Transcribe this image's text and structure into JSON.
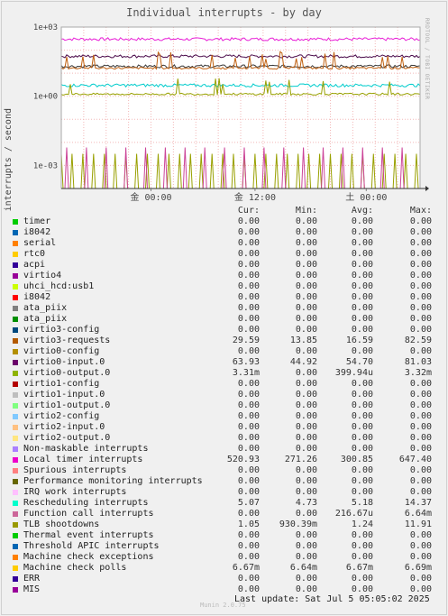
{
  "chart_data": {
    "type": "line",
    "title": "Individual interrupts - by day",
    "ylabel": "interrupts / second",
    "xlabel": "",
    "y_scale": "log",
    "ylim": [
      0.0001,
      1000
    ],
    "y_ticks": [
      {
        "value": 1000,
        "label": "1e+03"
      },
      {
        "value": 1,
        "label": "1e+00"
      },
      {
        "value": 0.001,
        "label": "1e-03"
      }
    ],
    "x_ticks": [
      "金 00:00",
      "金 12:00",
      "土 00:00"
    ],
    "grid": true,
    "series_levels": [
      {
        "name": "Local timer interrupts",
        "color": "#e81ed6",
        "value": 300.85,
        "style": "noisy"
      },
      {
        "name": "virtio0-input.0",
        "color": "#4a0a4a",
        "value": 54.7,
        "style": "noisy"
      },
      {
        "name": "Rescheduling interrupts",
        "color": "#3a3a3a",
        "value": 20,
        "style": "noisy"
      },
      {
        "name": "virtio3-requests",
        "color": "#c06010",
        "value": 16.59,
        "style": "spiky"
      },
      {
        "name": "Machine check polls",
        "color": "#00cccc",
        "value": 3,
        "style": "noisy"
      },
      {
        "name": "TLB shootdowns",
        "color": "#99a000",
        "value": 1.24,
        "style": "spiky"
      },
      {
        "name": "virtio0-output.0",
        "color": "#99a000",
        "value": 0.0004,
        "style": "spikes"
      },
      {
        "name": "Function call interrupts",
        "color": "#cc4499",
        "value": 0.0002,
        "style": "spikes2"
      }
    ]
  },
  "legend": {
    "headers": {
      "cur": "Cur:",
      "min": "Min:",
      "avg": "Avg:",
      "max": "Max:"
    },
    "rows": [
      {
        "name": "timer",
        "color": "#00cc00",
        "cur": "0.00",
        "min": "0.00",
        "avg": "0.00",
        "max": "0.00"
      },
      {
        "name": "i8042",
        "color": "#0066b3",
        "cur": "0.00",
        "min": "0.00",
        "avg": "0.00",
        "max": "0.00"
      },
      {
        "name": "serial",
        "color": "#ff8000",
        "cur": "0.00",
        "min": "0.00",
        "avg": "0.00",
        "max": "0.00"
      },
      {
        "name": "rtc0",
        "color": "#ffcc00",
        "cur": "0.00",
        "min": "0.00",
        "avg": "0.00",
        "max": "0.00"
      },
      {
        "name": "acpi",
        "color": "#330099",
        "cur": "0.00",
        "min": "0.00",
        "avg": "0.00",
        "max": "0.00"
      },
      {
        "name": "virtio4",
        "color": "#990099",
        "cur": "0.00",
        "min": "0.00",
        "avg": "0.00",
        "max": "0.00"
      },
      {
        "name": "uhci_hcd:usb1",
        "color": "#ccff00",
        "cur": "0.00",
        "min": "0.00",
        "avg": "0.00",
        "max": "0.00"
      },
      {
        "name": "i8042",
        "color": "#ff0000",
        "cur": "0.00",
        "min": "0.00",
        "avg": "0.00",
        "max": "0.00"
      },
      {
        "name": "ata_piix",
        "color": "#808080",
        "cur": "0.00",
        "min": "0.00",
        "avg": "0.00",
        "max": "0.00"
      },
      {
        "name": "ata_piix",
        "color": "#008f00",
        "cur": "0.00",
        "min": "0.00",
        "avg": "0.00",
        "max": "0.00"
      },
      {
        "name": "virtio3-config",
        "color": "#00487d",
        "cur": "0.00",
        "min": "0.00",
        "avg": "0.00",
        "max": "0.00"
      },
      {
        "name": "virtio3-requests",
        "color": "#b35a00",
        "cur": "29.59",
        "min": "13.85",
        "avg": "16.59",
        "max": "82.59"
      },
      {
        "name": "virtio0-config",
        "color": "#b38f00",
        "cur": "0.00",
        "min": "0.00",
        "avg": "0.00",
        "max": "0.00"
      },
      {
        "name": "virtio0-input.0",
        "color": "#6b006b",
        "cur": "63.93",
        "min": "44.92",
        "avg": "54.70",
        "max": "81.03"
      },
      {
        "name": "virtio0-output.0",
        "color": "#8fb300",
        "cur": "3.31m",
        "min": "0.00",
        "avg": "399.94u",
        "max": "3.32m"
      },
      {
        "name": "virtio1-config",
        "color": "#b30000",
        "cur": "0.00",
        "min": "0.00",
        "avg": "0.00",
        "max": "0.00"
      },
      {
        "name": "virtio1-input.0",
        "color": "#bebebe",
        "cur": "0.00",
        "min": "0.00",
        "avg": "0.00",
        "max": "0.00"
      },
      {
        "name": "virtio1-output.0",
        "color": "#80ff80",
        "cur": "0.00",
        "min": "0.00",
        "avg": "0.00",
        "max": "0.00"
      },
      {
        "name": "virtio2-config",
        "color": "#80c9ff",
        "cur": "0.00",
        "min": "0.00",
        "avg": "0.00",
        "max": "0.00"
      },
      {
        "name": "virtio2-input.0",
        "color": "#ffc080",
        "cur": "0.00",
        "min": "0.00",
        "avg": "0.00",
        "max": "0.00"
      },
      {
        "name": "virtio2-output.0",
        "color": "#ffe680",
        "cur": "0.00",
        "min": "0.00",
        "avg": "0.00",
        "max": "0.00"
      },
      {
        "name": "Non-maskable interrupts",
        "color": "#aa80ff",
        "cur": "0.00",
        "min": "0.00",
        "avg": "0.00",
        "max": "0.00"
      },
      {
        "name": "Local timer interrupts",
        "color": "#ee00cc",
        "cur": "520.93",
        "min": "271.26",
        "avg": "300.85",
        "max": "647.40"
      },
      {
        "name": "Spurious interrupts",
        "color": "#ff8080",
        "cur": "0.00",
        "min": "0.00",
        "avg": "0.00",
        "max": "0.00"
      },
      {
        "name": "Performance monitoring interrupts",
        "color": "#666600",
        "cur": "0.00",
        "min": "0.00",
        "avg": "0.00",
        "max": "0.00"
      },
      {
        "name": "IRQ work interrupts",
        "color": "#ffbfff",
        "cur": "0.00",
        "min": "0.00",
        "avg": "0.00",
        "max": "0.00"
      },
      {
        "name": "Rescheduling interrupts",
        "color": "#00ffcc",
        "cur": "5.07",
        "min": "4.73",
        "avg": "5.18",
        "max": "14.37"
      },
      {
        "name": "Function call interrupts",
        "color": "#cc6699",
        "cur": "0.00",
        "min": "0.00",
        "avg": "216.67u",
        "max": "6.64m"
      },
      {
        "name": "TLB shootdowns",
        "color": "#999900",
        "cur": "1.05",
        "min": "930.39m",
        "avg": "1.24",
        "max": "11.91"
      },
      {
        "name": "Thermal event interrupts",
        "color": "#00cc00",
        "cur": "0.00",
        "min": "0.00",
        "avg": "0.00",
        "max": "0.00"
      },
      {
        "name": "Threshold APIC interrupts",
        "color": "#0066b3",
        "cur": "0.00",
        "min": "0.00",
        "avg": "0.00",
        "max": "0.00"
      },
      {
        "name": "Machine check exceptions",
        "color": "#ff8000",
        "cur": "0.00",
        "min": "0.00",
        "avg": "0.00",
        "max": "0.00"
      },
      {
        "name": "Machine check polls",
        "color": "#ffcc00",
        "cur": "6.67m",
        "min": "6.64m",
        "avg": "6.67m",
        "max": "6.69m"
      },
      {
        "name": "ERR",
        "color": "#330099",
        "cur": "0.00",
        "min": "0.00",
        "avg": "0.00",
        "max": "0.00"
      },
      {
        "name": "MIS",
        "color": "#990099",
        "cur": "0.00",
        "min": "0.00",
        "avg": "0.00",
        "max": "0.00"
      }
    ]
  },
  "footer": {
    "last_update": "Last update: Sat Jul  5 05:05:02 2025"
  },
  "credit": "RRDTOOL / TOBI OETIKER",
  "generator": "Munin 2.0.75"
}
